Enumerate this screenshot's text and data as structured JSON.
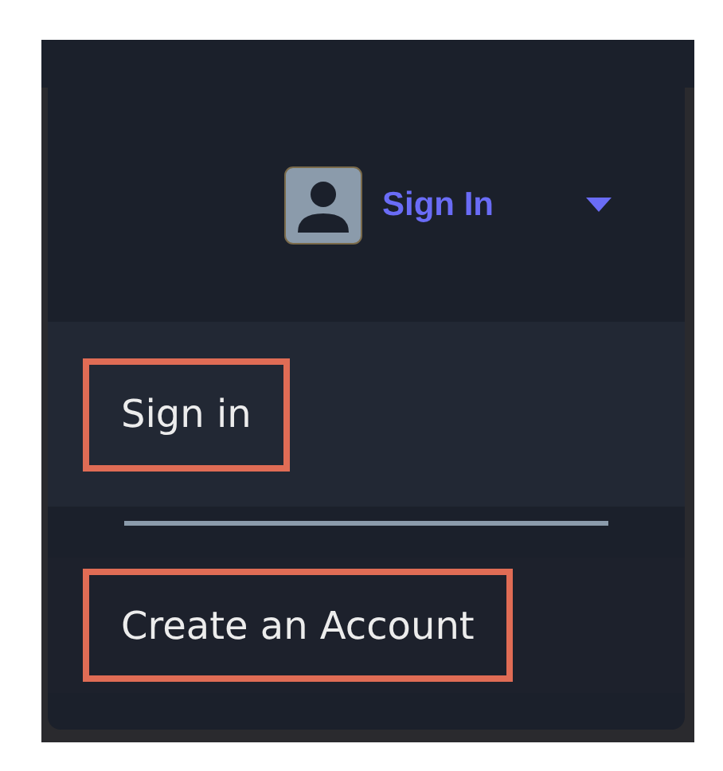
{
  "account_button": {
    "label": "Sign In"
  },
  "menu_items": [
    {
      "label": "Sign in",
      "selected": true,
      "outlined": true
    },
    {
      "label": "Create an Account",
      "selected": false,
      "outlined": true
    }
  ]
}
